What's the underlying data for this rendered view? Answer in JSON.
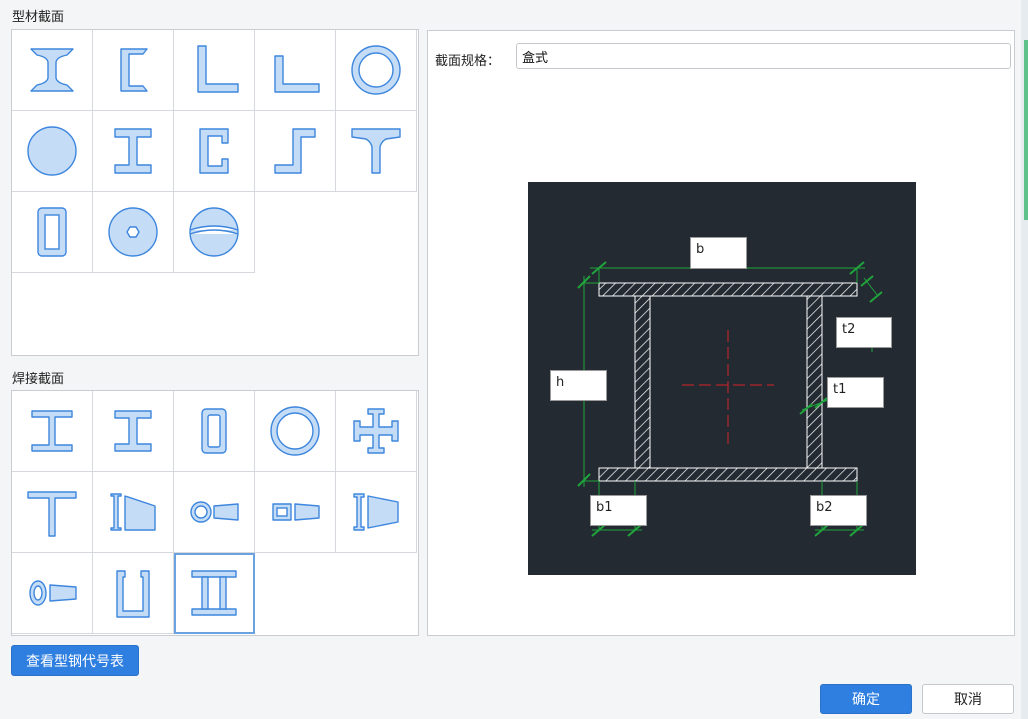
{
  "profile_section": {
    "title": "型材截面"
  },
  "welded_section": {
    "title": "焊接截面"
  },
  "spec": {
    "label": "截面规格：",
    "value": "盒式"
  },
  "dims": {
    "b": "b",
    "t2": "t2",
    "h": "h",
    "t1": "t1",
    "b1": "b1",
    "b2": "b2"
  },
  "buttons": {
    "view_table": "查看型钢代号表",
    "ok": "确定",
    "cancel": "取消"
  },
  "colors": {
    "accent": "#2f7fe0",
    "shape_fill": "#c5dcf7",
    "shape_stroke": "#3d86dd",
    "drawing_bg": "#232a31",
    "dim_green": "#20a43c"
  },
  "profile_icons": [
    "i-beam-icon",
    "channel-icon",
    "equal-angle-icon",
    "unequal-angle-icon",
    "pipe-icon",
    "round-bar-icon",
    "light-i-beam-icon",
    "cold-channel-icon",
    "z-section-icon",
    "t-section-icon",
    "rect-tube-icon",
    "hex-bar-icon",
    "half-round-icon"
  ],
  "welded_icons": [
    "welded-i-icon",
    "welded-h-icon",
    "welded-box-icon",
    "welded-pipe-icon",
    "cross-section-icon",
    "welded-t-icon",
    "tapered-i-icon",
    "tapered-pipe-icon",
    "tapered-box-icon",
    "tapered-h-icon",
    "tapered-round-icon",
    "u-section-icon",
    "box-section-icon"
  ],
  "selected_welded_index": 12
}
